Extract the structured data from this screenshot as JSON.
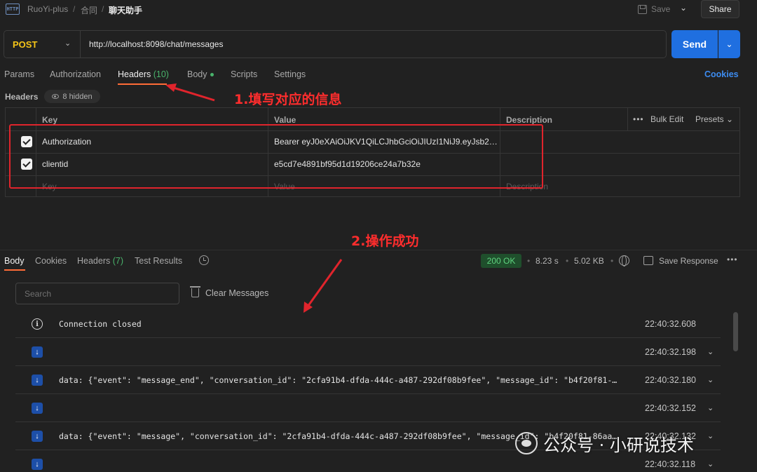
{
  "topbar": {
    "breadcrumbs": [
      "RuoYi-plus",
      "合同",
      "聊天助手"
    ],
    "separator": "/",
    "save_label": "Save",
    "share_label": "Share",
    "http_icon": "HTTP"
  },
  "request": {
    "method": "POST",
    "url": "http://localhost:8098/chat/messages",
    "send_label": "Send"
  },
  "request_tabs": {
    "params": "Params",
    "authorization": "Authorization",
    "headers": "Headers",
    "headers_count": "(10)",
    "body": "Body",
    "scripts": "Scripts",
    "settings": "Settings",
    "cookies": "Cookies"
  },
  "headers_section": {
    "title": "Headers",
    "hidden": "8 hidden",
    "columns": {
      "key": "Key",
      "value": "Value",
      "description": "Description"
    },
    "bulk_edit": "Bulk Edit",
    "presets": "Presets",
    "rows": [
      {
        "key": "Authorization",
        "value": "Bearer eyJ0eXAiOiJKV1QiLCJhbGciOiJIUzI1NiJ9.eyJsb2…",
        "checked": true
      },
      {
        "key": "clientid",
        "value": "e5cd7e4891bf95d1d19206ce24a7b32e",
        "checked": true
      }
    ],
    "placeholders": {
      "key": "Key",
      "value": "Value",
      "description": "Description"
    }
  },
  "annotations": {
    "note1": "1.填写对应的信息",
    "note2": "2.操作成功"
  },
  "response": {
    "tabs": {
      "body": "Body",
      "cookies": "Cookies",
      "headers": "Headers",
      "headers_count": "(7)",
      "test_results": "Test Results"
    },
    "status": "200 OK",
    "time": "8.23 s",
    "size": "5.02 KB",
    "save_response": "Save Response",
    "search_placeholder": "Search",
    "clear_messages": "Clear Messages",
    "messages": [
      {
        "type": "info",
        "text": "Connection closed",
        "time": "22:40:32.608",
        "expandable": false
      },
      {
        "type": "down",
        "text": "",
        "time": "22:40:32.198",
        "expandable": true
      },
      {
        "type": "down",
        "text": "data: {\"event\": \"message_end\", \"conversation_id\": \"2cfa91b4-dfda-444c-a487-292df08b9fee\", \"message_id\": \"b4f20f81-…",
        "time": "22:40:32.180",
        "expandable": true
      },
      {
        "type": "down",
        "text": "",
        "time": "22:40:32.152",
        "expandable": true
      },
      {
        "type": "down",
        "text": "data: {\"event\": \"message\", \"conversation_id\": \"2cfa91b4-dfda-444c-a487-292df08b9fee\", \"message_id\": \"b4f20f81-86aa…",
        "time": "22:40:32.132",
        "expandable": true
      },
      {
        "type": "down",
        "text": "",
        "time": "22:40:32.118",
        "expandable": true
      }
    ]
  },
  "watermark": "公众号 · 小研说技术",
  "colors": {
    "accent_blue": "#1f6fe0",
    "method_yellow": "#f5c518",
    "success_green": "#49b36b",
    "annotation_red": "#e0242c",
    "tab_underline": "#ff6c37"
  }
}
